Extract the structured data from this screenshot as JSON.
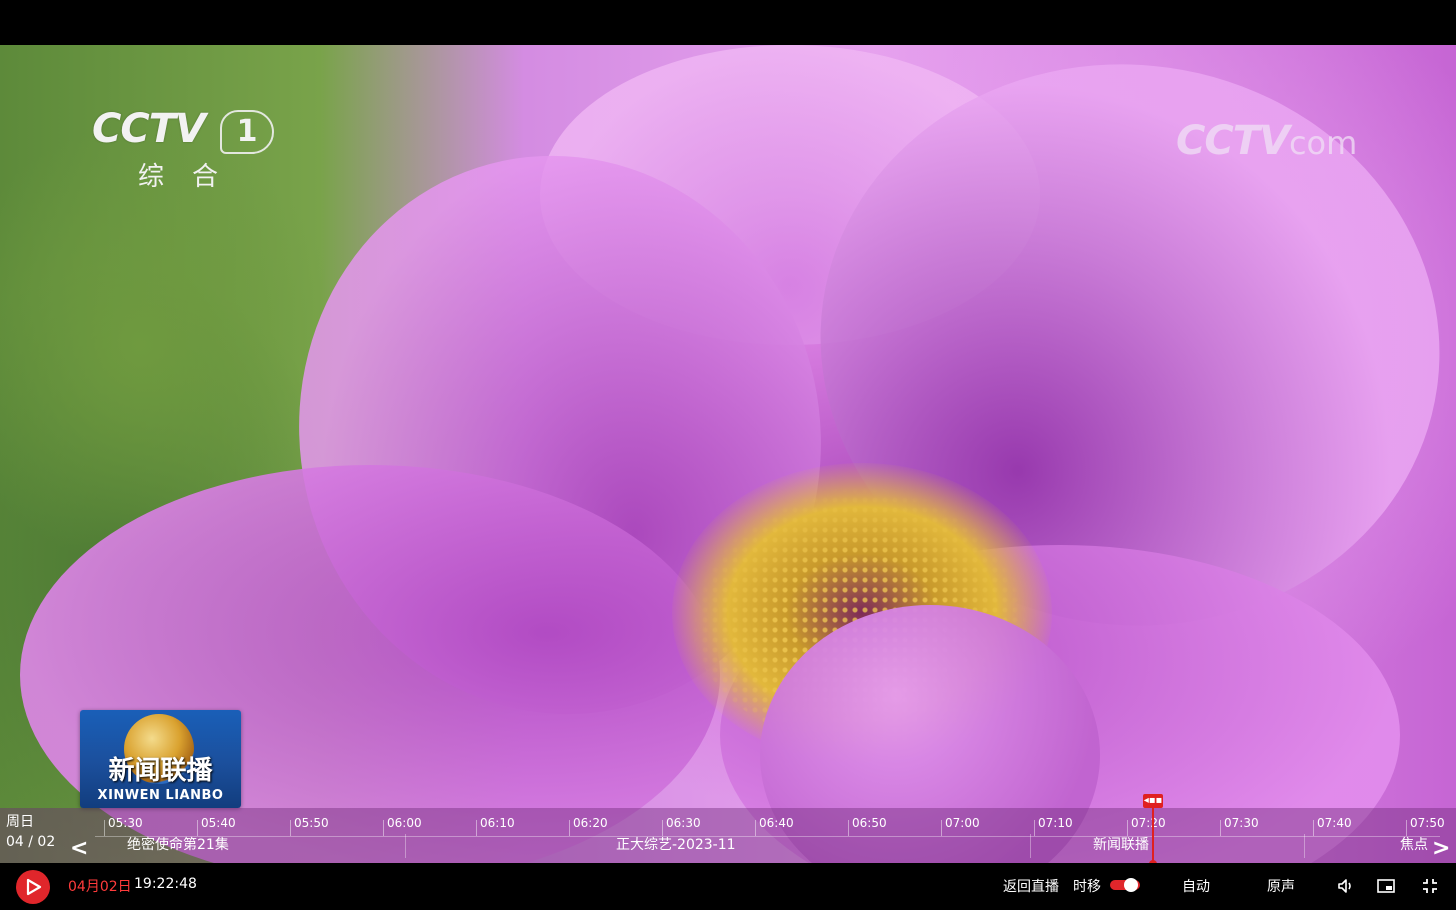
{
  "logos": {
    "cctv1_word": "CCTV",
    "cctv1_number": "1",
    "cctv1_sub": "综合",
    "watermark_main": "CCTV",
    "watermark_suffix": "com",
    "program_logo_cn": "新闻联播",
    "program_logo_en": "XINWEN LIANBO"
  },
  "timeline": {
    "day_label": "周日",
    "date": "04 / 02",
    "ticks": [
      "05:30",
      "05:40",
      "05:50",
      "06:00",
      "06:10",
      "06:20",
      "06:30",
      "06:40",
      "06:50",
      "07:00",
      "07:10",
      "07:20",
      "07:30",
      "07:40",
      "07:50"
    ],
    "programs": [
      "绝密使命第21集",
      "正大综艺-2023-11",
      "新闻联播",
      "焦点"
    ],
    "prev_arrow": "<",
    "next_arrow": ">",
    "playhead_label": "◂▪▪"
  },
  "controls": {
    "date": "04月02日",
    "time": "19:22:48",
    "return_live": "返回直播",
    "timeshift": "时移",
    "quality": "自动",
    "audio": "原声"
  },
  "colors": {
    "accent_red": "#e0262b",
    "timeline_bg": "rgba(110,40,120,.42)"
  },
  "icons": [
    "play-icon",
    "volume-icon",
    "pip-icon",
    "fullscreen-exit-icon"
  ]
}
